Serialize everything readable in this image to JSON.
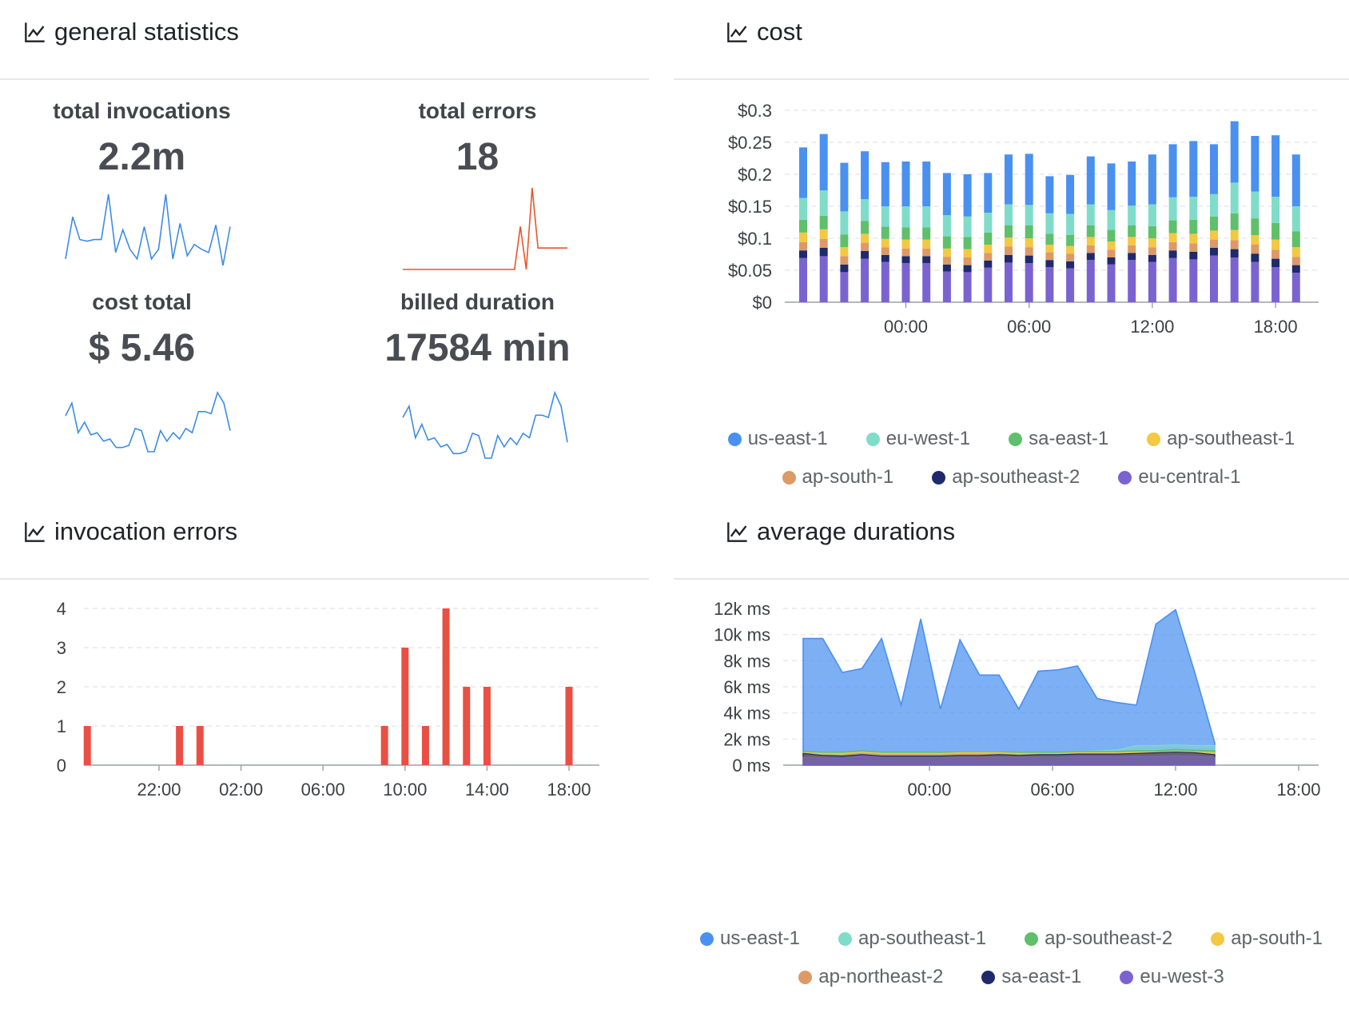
{
  "panels": {
    "general_title": "general statistics",
    "cost_title": "cost",
    "errors_title": "invocation errors",
    "durations_title": "average durations"
  },
  "stats": [
    {
      "label": "total invocations",
      "value": "2.2m",
      "color": "#3b8be8"
    },
    {
      "label": "total errors",
      "value": "18",
      "color": "#e8552a"
    },
    {
      "label": "cost total",
      "value": "$ 5.46",
      "color": "#3b8be8"
    },
    {
      "label": "billed duration",
      "value": "17584 min",
      "color": "#3b8be8"
    }
  ],
  "colors": {
    "us-east-1": "#4a90f0",
    "eu-west-1": "#7fdcc9",
    "sa-east-1": "#5fbf6a",
    "ap-southeast-1": "#f3c843",
    "ap-south-1": "#dd9966",
    "ap-southeast-2": "#1e2a6b",
    "eu-central-1": "#7a63d1",
    "error_bar": "#ea4f43",
    "grid": "#e3e4e6"
  },
  "chart_data": [
    {
      "id": "sparklines",
      "type": "line",
      "series": [
        {
          "values": [
            1.0,
            3.6,
            2.2,
            2.1,
            2.2,
            2.2,
            5.0,
            1.4,
            2.8,
            1.6,
            1.0,
            3.0,
            1.0,
            1.6,
            5.0,
            1.0,
            3.2,
            1.2,
            1.9,
            1.6,
            1.4,
            3.1,
            0.6,
            3.0
          ]
        },
        {
          "values": [
            0,
            0,
            0,
            0,
            0,
            0,
            0,
            0,
            0,
            0,
            0,
            0,
            0,
            0,
            0,
            0,
            0,
            0,
            0,
            0,
            2,
            0,
            3.8,
            1,
            1,
            1,
            1,
            1,
            1
          ]
        },
        {
          "values": [
            3.0,
            3.6,
            2.2,
            2.7,
            2.1,
            2.2,
            1.8,
            1.9,
            1.5,
            1.5,
            1.6,
            2.4,
            2.3,
            1.3,
            1.3,
            2.3,
            1.8,
            2.2,
            1.9,
            2.4,
            2.2,
            3.2,
            3.2,
            3.1,
            4.1,
            3.6,
            2.3
          ]
        },
        {
          "values": [
            3.1,
            3.6,
            2.2,
            2.8,
            2.1,
            2.2,
            1.8,
            1.9,
            1.5,
            1.5,
            1.6,
            2.4,
            2.3,
            1.3,
            1.3,
            2.3,
            1.8,
            2.2,
            1.9,
            2.4,
            2.2,
            3.2,
            3.2,
            3.1,
            4.2,
            3.6,
            2.0
          ]
        }
      ]
    },
    {
      "id": "cost",
      "type": "bar",
      "stacked": true,
      "x_ticks": [
        "00:00",
        "06:00",
        "12:00",
        "18:00"
      ],
      "ylim": [
        0,
        0.3
      ],
      "y_ticks": [
        "$0",
        "$0.05",
        "$0.1",
        "$0.15",
        "$0.2",
        "$0.25",
        "$0.3"
      ],
      "series": [
        {
          "name": "us-east-1",
          "values": [
            0.079,
            0.088,
            0.076,
            0.075,
            0.069,
            0.07,
            0.07,
            0.066,
            0.066,
            0.062,
            0.078,
            0.08,
            0.058,
            0.061,
            0.075,
            0.073,
            0.069,
            0.078,
            0.083,
            0.087,
            0.078,
            0.096,
            0.087,
            0.096,
            0.081
          ]
        },
        {
          "name": "eu-west-1",
          "values": [
            0.034,
            0.04,
            0.036,
            0.034,
            0.032,
            0.033,
            0.033,
            0.033,
            0.032,
            0.031,
            0.033,
            0.032,
            0.032,
            0.033,
            0.033,
            0.031,
            0.031,
            0.034,
            0.036,
            0.036,
            0.035,
            0.048,
            0.042,
            0.041,
            0.039
          ]
        },
        {
          "name": "sa-east-1",
          "values": [
            0.02,
            0.021,
            0.02,
            0.02,
            0.019,
            0.019,
            0.019,
            0.019,
            0.019,
            0.019,
            0.019,
            0.02,
            0.017,
            0.017,
            0.018,
            0.018,
            0.018,
            0.019,
            0.02,
            0.022,
            0.022,
            0.026,
            0.026,
            0.026,
            0.025
          ]
        },
        {
          "name": "ap-southeast-1",
          "values": [
            0.015,
            0.015,
            0.014,
            0.014,
            0.013,
            0.014,
            0.014,
            0.013,
            0.013,
            0.013,
            0.014,
            0.014,
            0.012,
            0.012,
            0.013,
            0.013,
            0.013,
            0.014,
            0.014,
            0.015,
            0.014,
            0.016,
            0.015,
            0.016,
            0.015
          ]
        },
        {
          "name": "ap-south-1",
          "values": [
            0.013,
            0.014,
            0.013,
            0.013,
            0.012,
            0.012,
            0.012,
            0.012,
            0.012,
            0.012,
            0.013,
            0.013,
            0.012,
            0.012,
            0.012,
            0.012,
            0.012,
            0.012,
            0.013,
            0.013,
            0.013,
            0.014,
            0.014,
            0.014,
            0.013
          ]
        },
        {
          "name": "ap-southeast-2",
          "values": [
            0.012,
            0.013,
            0.012,
            0.012,
            0.011,
            0.011,
            0.011,
            0.011,
            0.011,
            0.011,
            0.012,
            0.012,
            0.011,
            0.011,
            0.011,
            0.011,
            0.011,
            0.011,
            0.012,
            0.012,
            0.012,
            0.013,
            0.013,
            0.013,
            0.012
          ]
        },
        {
          "name": "eu-central-1",
          "values": [
            0.069,
            0.072,
            0.047,
            0.068,
            0.063,
            0.061,
            0.061,
            0.048,
            0.047,
            0.054,
            0.062,
            0.061,
            0.055,
            0.053,
            0.066,
            0.059,
            0.066,
            0.063,
            0.069,
            0.067,
            0.073,
            0.07,
            0.063,
            0.055,
            0.046
          ]
        }
      ]
    },
    {
      "id": "errors",
      "type": "bar",
      "x_ticks": [
        "22:00",
        "02:00",
        "06:00",
        "10:00",
        "14:00",
        "18:00"
      ],
      "ylim": [
        0,
        4
      ],
      "y_ticks": [
        "0",
        "1",
        "2",
        "3",
        "4"
      ],
      "x_hours": [
        -5.5,
        -1.0,
        0.0,
        9.0,
        10.0,
        11.0,
        12.0,
        13.0,
        14.0,
        18.0
      ],
      "values": [
        1,
        1,
        1,
        1,
        3,
        1,
        4,
        2,
        2,
        2
      ]
    },
    {
      "id": "durations",
      "type": "area",
      "x_ticks": [
        "00:00",
        "06:00",
        "12:00",
        "18:00"
      ],
      "ylim": [
        0,
        12000
      ],
      "y_ticks": [
        "0 ms",
        "2k ms",
        "4k ms",
        "6k ms",
        "8k ms",
        "10k ms",
        "12k ms"
      ],
      "series": [
        {
          "name": "us-east-1",
          "values": [
            9700,
            9700,
            7100,
            7400,
            9700,
            4600,
            11200,
            4300,
            9600,
            6900,
            6900,
            4300,
            7200,
            7300,
            7600,
            5100,
            4800,
            4600,
            10800,
            11900,
            7000,
            1700
          ]
        },
        {
          "name": "ap-southeast-1",
          "values": [
            1000,
            1000,
            950,
            1050,
            950,
            950,
            950,
            950,
            1000,
            1000,
            1000,
            950,
            1000,
            1000,
            1050,
            1100,
            1150,
            1500,
            1500,
            1550,
            1500,
            1500
          ]
        },
        {
          "name": "ap-southeast-2",
          "values": [
            1050,
            1000,
            980,
            1100,
            1000,
            1000,
            1000,
            980,
            1000,
            1000,
            1000,
            980,
            1000,
            1000,
            1050,
            1050,
            1050,
            1100,
            1100,
            1200,
            1150,
            1100
          ]
        },
        {
          "name": "ap-south-1",
          "values": [
            950,
            900,
            900,
            1000,
            900,
            900,
            900,
            900,
            950,
            950,
            950,
            900,
            900,
            900,
            950,
            950,
            950,
            1000,
            1000,
            1050,
            1000,
            950
          ]
        },
        {
          "name": "ap-northeast-2",
          "values": [
            800,
            780,
            760,
            900,
            800,
            800,
            800,
            780,
            800,
            800,
            800,
            780,
            800,
            800,
            820,
            820,
            820,
            850,
            850,
            900,
            850,
            800
          ]
        },
        {
          "name": "sa-east-1",
          "values": [
            900,
            750,
            700,
            800,
            700,
            700,
            700,
            700,
            750,
            750,
            800,
            750,
            800,
            800,
            850,
            850,
            850,
            900,
            950,
            1000,
            950,
            800
          ]
        },
        {
          "name": "eu-west-3",
          "values": [
            600,
            550,
            500,
            700,
            600,
            600,
            600,
            600,
            600,
            600,
            600,
            600,
            600,
            600,
            620,
            620,
            620,
            650,
            650,
            700,
            650,
            600
          ]
        }
      ]
    }
  ],
  "cost_legend": [
    {
      "label": "us-east-1",
      "color": "#4a90f0"
    },
    {
      "label": "eu-west-1",
      "color": "#7fdcc9"
    },
    {
      "label": "sa-east-1",
      "color": "#5fbf6a"
    },
    {
      "label": "ap-southeast-1",
      "color": "#f3c843"
    },
    {
      "label": "ap-south-1",
      "color": "#dd9966"
    },
    {
      "label": "ap-southeast-2",
      "color": "#1e2a6b"
    },
    {
      "label": "eu-central-1",
      "color": "#7a63d1"
    }
  ],
  "durations_legend": [
    {
      "label": "us-east-1",
      "color": "#4a90f0"
    },
    {
      "label": "ap-southeast-1",
      "color": "#7fdcc9"
    },
    {
      "label": "ap-southeast-2",
      "color": "#5fbf6a"
    },
    {
      "label": "ap-south-1",
      "color": "#f3c843"
    },
    {
      "label": "ap-northeast-2",
      "color": "#dd9966"
    },
    {
      "label": "sa-east-1",
      "color": "#1e2a6b"
    },
    {
      "label": "eu-west-3",
      "color": "#7a63d1"
    }
  ]
}
